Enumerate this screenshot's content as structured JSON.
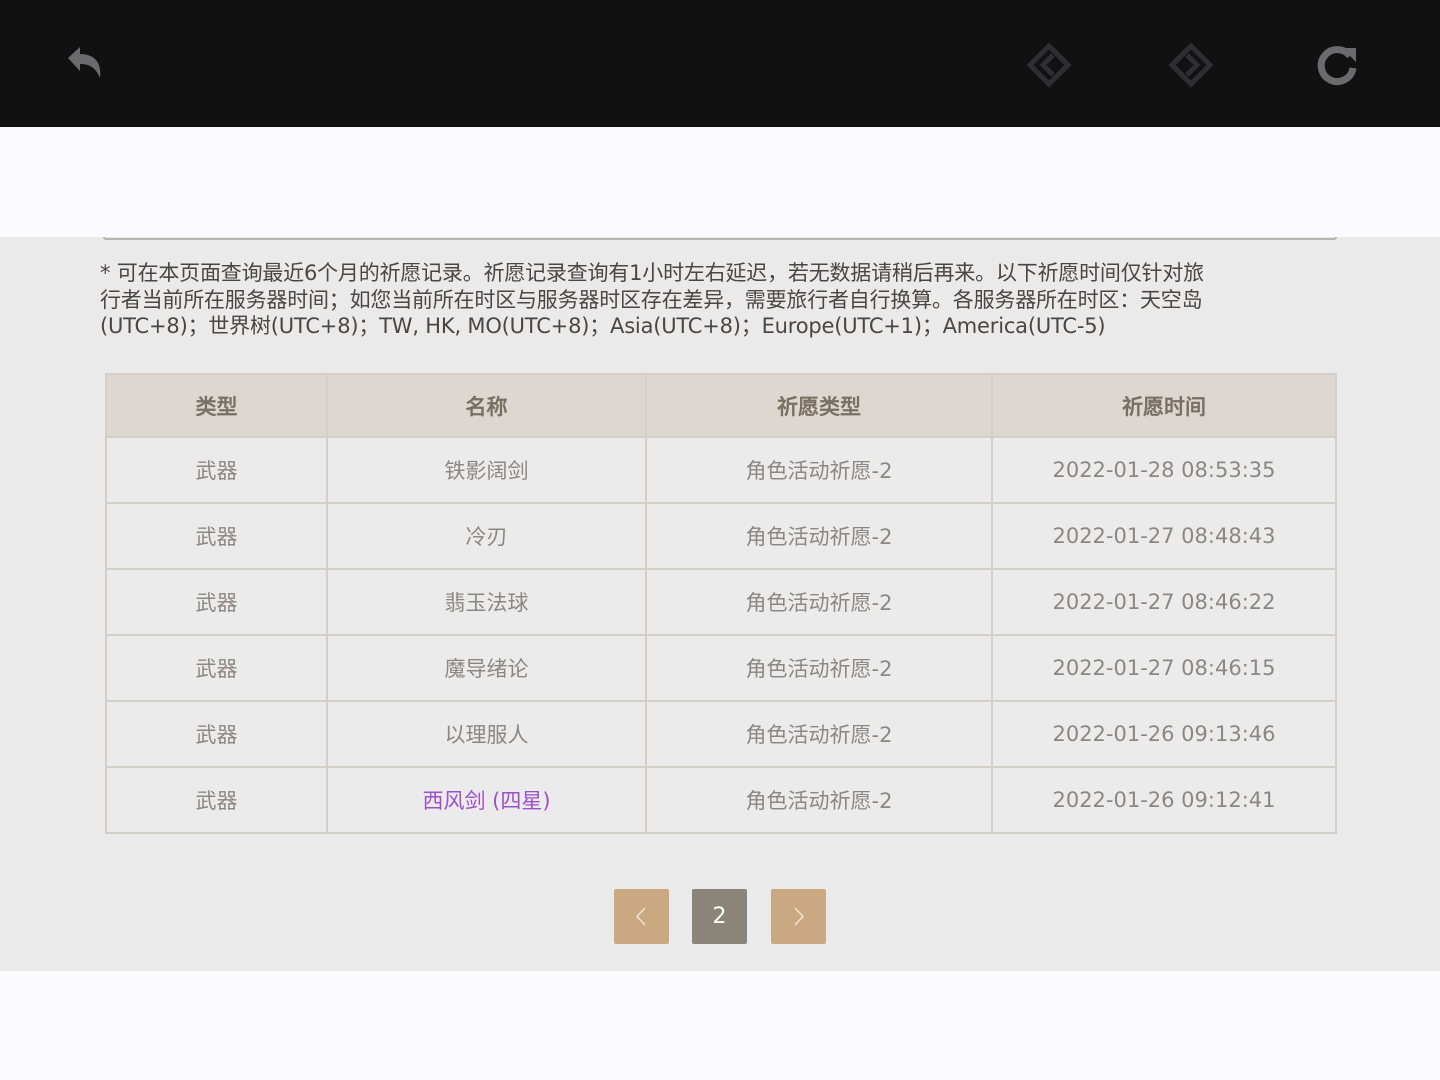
{
  "browser_bar": {
    "icons": [
      "back-arrow-icon",
      "prev-diamond-icon",
      "next-diamond-icon",
      "reload-icon"
    ]
  },
  "notice": "* 可在本页面查询最近6个月的祈愿记录。祈愿记录查询有1小时左右延迟，若无数据请稍后再来。以下祈愿时间仅针对旅\n行者当前所在服务器时间；如您当前所在时区与服务器时区存在差异，需要旅行者自行换算。各服务器所在时区：天空岛\n(UTC+8)；世界树(UTC+8)；TW, HK, MO(UTC+8)；Asia(UTC+8)；Europe(UTC+1)；America(UTC-5)",
  "table": {
    "headers": [
      "类型",
      "名称",
      "祈愿类型",
      "祈愿时间"
    ],
    "rows": [
      {
        "type": "武器",
        "name": "铁影阔剑",
        "wish_type": "角色活动祈愿-2",
        "time": "2022-01-28 08:53:35",
        "rarity": 3
      },
      {
        "type": "武器",
        "name": "冷刃",
        "wish_type": "角色活动祈愿-2",
        "time": "2022-01-27 08:48:43",
        "rarity": 3
      },
      {
        "type": "武器",
        "name": "翡玉法球",
        "wish_type": "角色活动祈愿-2",
        "time": "2022-01-27 08:46:22",
        "rarity": 3
      },
      {
        "type": "武器",
        "name": "魔导绪论",
        "wish_type": "角色活动祈愿-2",
        "time": "2022-01-27 08:46:15",
        "rarity": 3
      },
      {
        "type": "武器",
        "name": "以理服人",
        "wish_type": "角色活动祈愿-2",
        "time": "2022-01-26 09:13:46",
        "rarity": 3
      },
      {
        "type": "武器",
        "name": "西风剑 (四星)",
        "wish_type": "角色活动祈愿-2",
        "time": "2022-01-26 09:12:41",
        "rarity": 4
      }
    ]
  },
  "pagination": {
    "current_page": "2",
    "prev_icon": "chevron-left-icon",
    "next_icon": "chevron-right-icon"
  },
  "colors": {
    "header_bg": "#dcd7d1",
    "rarity_4": "#9a50cf",
    "pager_active": "#8b8579",
    "pager_nav": "#c9a882"
  }
}
